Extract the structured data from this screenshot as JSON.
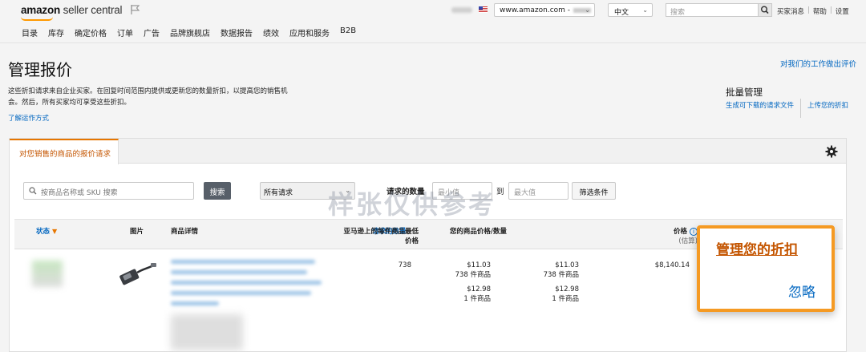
{
  "header": {
    "logo_bold": "amazon",
    "logo_light": " seller central",
    "nav": [
      "目录",
      "库存",
      "确定价格",
      "订单",
      "广告",
      "品牌旗舰店",
      "数据报告",
      "绩效",
      "应用和服务",
      "B2B"
    ],
    "marketplace": "www.amazon.com -",
    "language": "中文",
    "search_placeholder": "搜索",
    "links": [
      "买家消息",
      "帮助",
      "设置"
    ]
  },
  "page": {
    "title": "管理报价",
    "feedback": "对我们的工作做出评价",
    "description": "这些折扣请求来自企业买家。在回复时间范围内提供或更新您的数量折扣，以提高您的销售机会。然后，所有买家均可享受这些折扣。",
    "learn_more": "了解运作方式",
    "bulk_title": "批量管理",
    "bulk_download": "生成可下载的请求文件",
    "bulk_upload": "上传您的折扣"
  },
  "tab": {
    "label": "对您销售的商品的报价请求"
  },
  "filters": {
    "search_placeholder": "按商品名称或 SKU 搜索",
    "search_button": "搜索",
    "request_select": "所有请求",
    "qty_label": "请求的数量",
    "min_placeholder": "最小值",
    "to_label": "到",
    "max_placeholder": "最大值",
    "condition_button": "筛选条件"
  },
  "watermark": "样张仅供参考",
  "table": {
    "headers": {
      "status": "状态",
      "image": "图片",
      "details": "商品详情",
      "req_qty": "请求的数量",
      "low_price_1": "亚马逊上的每件商品最低",
      "low_price_2": "价格",
      "your_price": "您的商品价格/数量",
      "price": "价格",
      "price_sub": "(估算)"
    },
    "row": {
      "qty": "738",
      "low_price_a": "$11.03",
      "low_qty_a": "738 件商品",
      "low_price_b": "$12.98",
      "low_qty_b": "1 件商品",
      "your_price_a": "$11.03",
      "your_qty_a": "738 件商品",
      "your_price_b": "$12.98",
      "your_qty_b": "1 件商品",
      "total": "$8,140.14"
    }
  },
  "actions": {
    "manage": "管理您的折扣",
    "ignore": "忽略"
  },
  "colors": {
    "accent_orange": "#f59a23",
    "link_blue": "#0066c0",
    "tab_orange": "#c45500"
  }
}
